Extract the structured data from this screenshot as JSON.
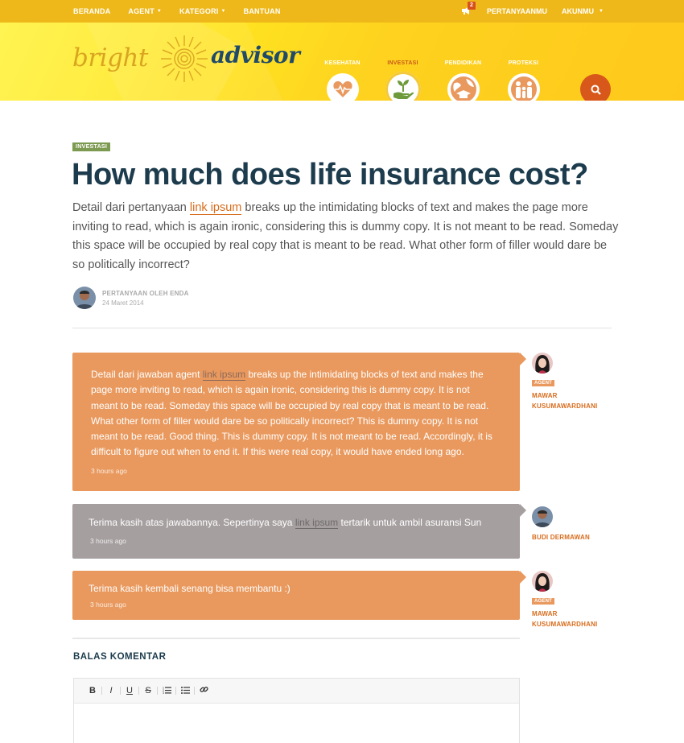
{
  "topnav": {
    "items": [
      {
        "label": "BERANDA",
        "dropdown": false
      },
      {
        "label": "AGENT",
        "dropdown": true
      },
      {
        "label": "KATEGORI",
        "dropdown": true
      },
      {
        "label": "BANTUAN",
        "dropdown": false
      }
    ],
    "notification_count": "2",
    "my_questions": "PERTANYAANMU",
    "account": "AKUNMU"
  },
  "brand": {
    "word1": "bright",
    "word2": "advisor"
  },
  "categories": [
    {
      "label": "KESEHATAN",
      "icon": "heart-pulse-icon",
      "active": false
    },
    {
      "label": "INVESTASI",
      "icon": "hand-plant-icon",
      "active": true
    },
    {
      "label": "PENDIDIKAN",
      "icon": "graduation-globe-icon",
      "active": false
    },
    {
      "label": "PROTEKSI",
      "icon": "family-icon",
      "active": false
    }
  ],
  "colors": {
    "accent": "#d8571b",
    "header": "#fed21f",
    "answer_agent": "#e9995e",
    "answer_user": "#a69fa0",
    "title": "#1c3b4c"
  },
  "question": {
    "tag": "INVESTASI",
    "title": "How much does life insurance cost?",
    "body_before": "Detail dari pertanyaan ",
    "body_link": "link ipsum",
    "body_after": " breaks up the intimidating blocks of text and makes the page more inviting to read, which is again ironic, considering this is dummy copy. It is not meant to be read. Someday this space will be occupied by real copy that is meant to be read. What other form of filler would dare be so politically incorrect?",
    "asked_by": "PERTANYAAN OLEH ENDA",
    "date": "24 Maret 2014"
  },
  "answers": [
    {
      "before": "Detail dari jawaban agent ",
      "link": "link ipsum",
      "after": " breaks up the intimidating blocks of text and makes the page more inviting to read, which is again ironic, considering this is dummy copy. It is not meant to be read. Someday this space will be occupied by real copy that is meant to be read. What other form of filler would dare be so politically incorrect? This is dummy copy. It is not meant to be read. Good thing. This is dummy copy. It is not meant to be read. Accordingly, it is difficult to figure out when to end it. If this were real copy, it would have ended long ago.",
      "time": "3 hours ago",
      "author_badge": "AGENT",
      "author_name": "MAWAR KUSUMAWARDHANI"
    },
    {
      "before": "Terima kasih atas jawabannya. Sepertinya saya ",
      "link": "link ipsum",
      "after": " tertarik untuk ambil asuransi Sun",
      "time": "3 hours ago",
      "author_name": "BUDI DERMAWAN"
    },
    {
      "text": "Terima kasih kembali senang bisa membantu :)",
      "time": "3 hours ago",
      "author_badge": "AGENT",
      "author_name": "MAWAR KUSUMAWARDHANI"
    }
  ],
  "reply": {
    "title": "BALAS KOMENTAR",
    "toolbar": [
      "B",
      "I",
      "U",
      "S",
      "ordered-list-icon",
      "bullet-list-icon",
      "link-icon"
    ]
  }
}
